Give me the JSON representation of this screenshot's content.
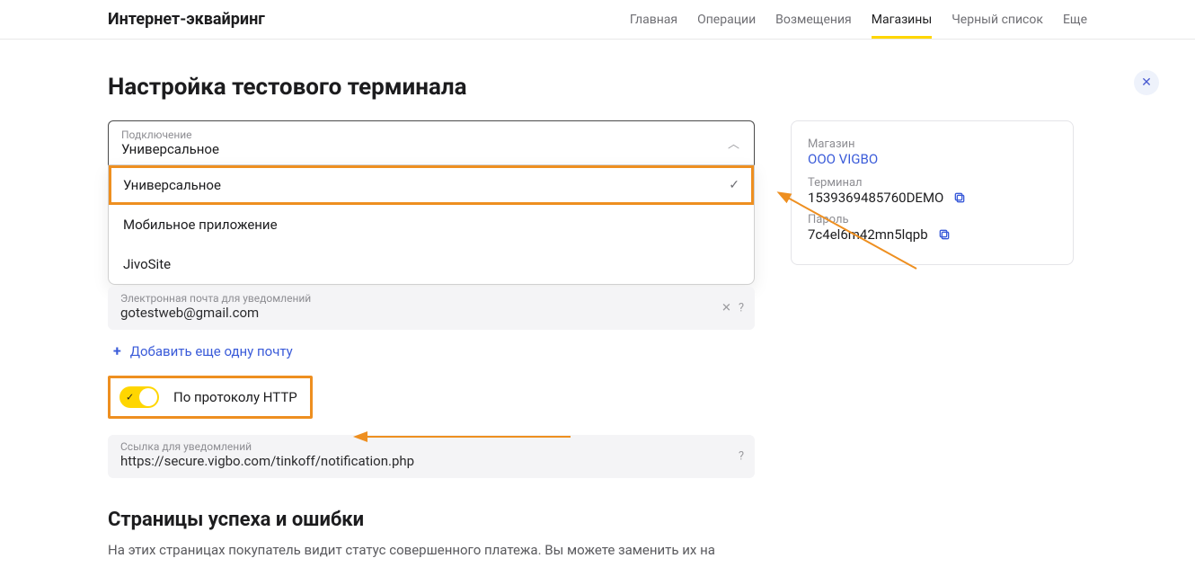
{
  "header": {
    "brand": "Интернет-эквайринг",
    "nav": [
      "Главная",
      "Операции",
      "Возмещения",
      "Магазины",
      "Черный список",
      "Еще"
    ],
    "active_index": 3
  },
  "page": {
    "title": "Настройка тестового терминала",
    "connection_select": {
      "label": "Подключение",
      "value": "Универсальное",
      "options": [
        "Универсальное",
        "Мобильное приложение",
        "JivoSite"
      ],
      "selected_index": 0
    },
    "email_field": {
      "label": "Электронная почта для уведомлений",
      "value": "gotestweb@gmail.com"
    },
    "add_email_link": "Добавить еще одну почту",
    "http_toggle": {
      "label": "По протоколу HTTP",
      "on": true
    },
    "notif_url": {
      "label": "Ссылка для уведомлений",
      "value": "https://secure.vigbo.com/tinkoff/notification.php"
    },
    "section2_title": "Страницы успеха и ошибки",
    "section2_desc": "На этих страницах покупатель видит статус совершенного платежа. Вы можете заменить их на"
  },
  "sidebar": {
    "shop_label": "Магазин",
    "shop_name": "ООО VIGBO",
    "terminal_label": "Терминал",
    "terminal_value": "1539369485760DEMO",
    "password_label": "Пароль",
    "password_value": "7c4el6m42mn5lqpb"
  }
}
